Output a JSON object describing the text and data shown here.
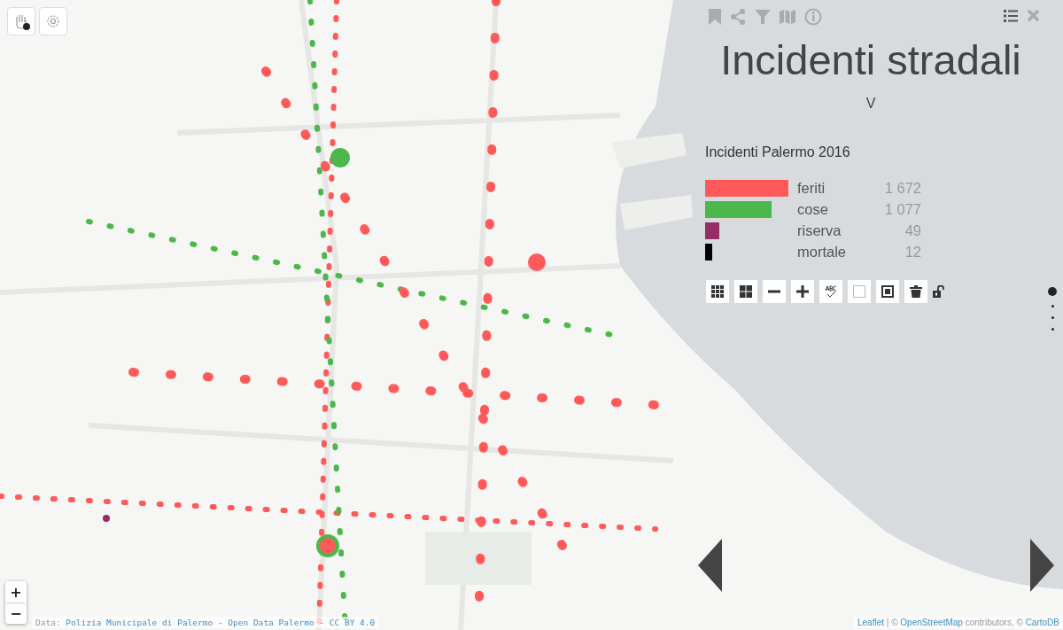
{
  "map_controls": {
    "zoom_in": "+",
    "zoom_out": "−"
  },
  "panel": {
    "title": "Incidenti stradali",
    "subtitle": "V",
    "legend_title": "Incidenti Palermo 2016",
    "legend": [
      {
        "label": "feriti",
        "value": "1 672",
        "color": "#ff5a5a"
      },
      {
        "label": "cose",
        "value": "1 077",
        "color": "#4cb84c"
      },
      {
        "label": "riserva",
        "value": "49",
        "color": "#962d64"
      },
      {
        "label": "mortale",
        "value": "12",
        "color": "#000000"
      }
    ],
    "pages": [
      {
        "selected": true
      },
      {
        "selected": false
      },
      {
        "selected": false
      },
      {
        "selected": false
      }
    ]
  },
  "attribution_left": [
    {
      "kind": "text",
      "text": "Data:"
    },
    {
      "kind": "link",
      "text": "Polizia Municipale di Palermo - Open Data Palermo - CC BY 4.0"
    }
  ],
  "attribution_right": [
    {
      "kind": "link",
      "text": "Leaflet"
    },
    {
      "kind": "text",
      "text": "| ©"
    },
    {
      "kind": "link",
      "text": "OpenStreetMap"
    },
    {
      "kind": "text",
      "text": "contributors, ©"
    },
    {
      "kind": "link",
      "text": "CartoDB"
    }
  ]
}
